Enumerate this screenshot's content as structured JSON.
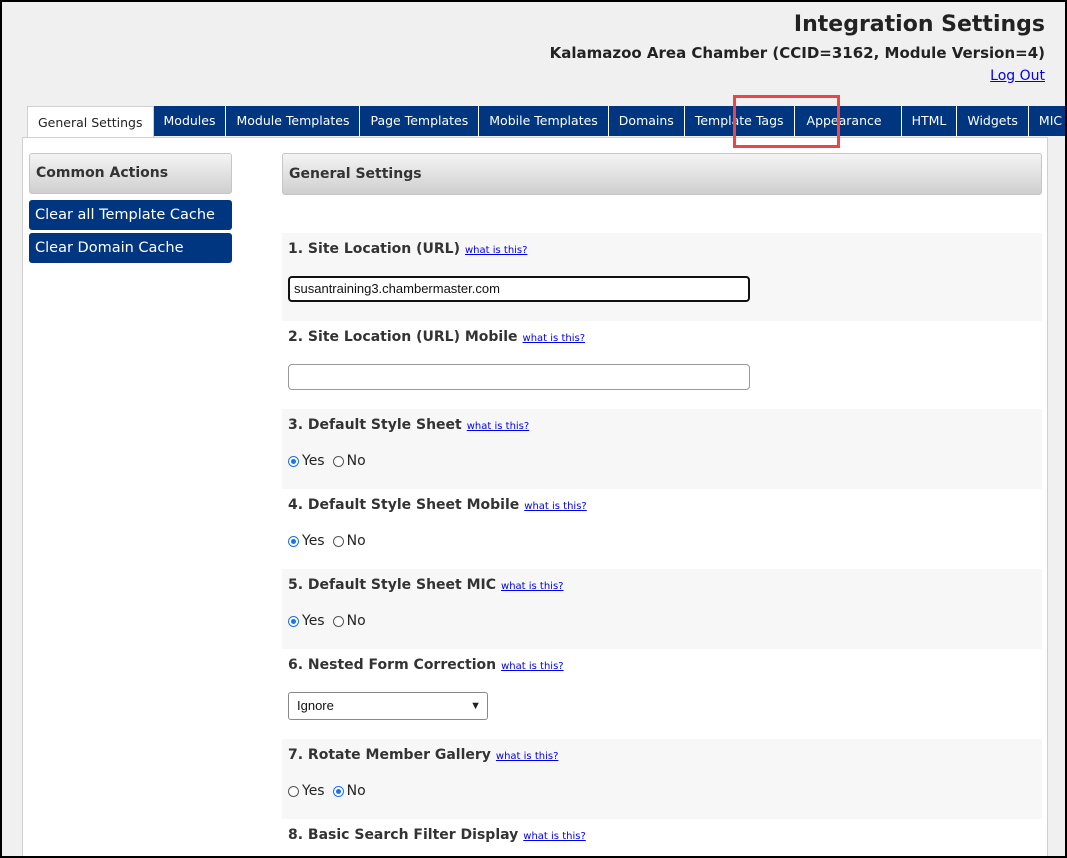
{
  "header": {
    "title": "Integration Settings",
    "subtitle": "Kalamazoo Area Chamber (CCID=3162, Module Version=4)",
    "logout": "Log Out"
  },
  "tabs": [
    {
      "label": "General Settings",
      "active": true
    },
    {
      "label": "Modules"
    },
    {
      "label": "Module Templates"
    },
    {
      "label": "Page Templates"
    },
    {
      "label": "Mobile Templates"
    },
    {
      "label": "Domains"
    },
    {
      "label": "Template Tags"
    },
    {
      "label": "Appearance",
      "highlighted": true
    },
    {
      "label": "HTML"
    },
    {
      "label": "Widgets"
    },
    {
      "label": "MIC"
    }
  ],
  "sidebar": {
    "title": "Common Actions",
    "actions": [
      "Clear all Template Cache",
      "Clear Domain Cache"
    ]
  },
  "main": {
    "title": "General Settings",
    "help_link": "what is this?",
    "fields": [
      {
        "label": "1. Site Location (URL)",
        "value": "susantraining3.chambermaster.com"
      },
      {
        "label": "2. Site Location (URL) Mobile",
        "value": ""
      },
      {
        "label": "3. Default Style Sheet",
        "yes": "Yes",
        "no": "No",
        "selected": "Yes"
      },
      {
        "label": "4. Default Style Sheet Mobile",
        "yes": "Yes",
        "no": "No",
        "selected": "Yes"
      },
      {
        "label": "5. Default Style Sheet MIC",
        "yes": "Yes",
        "no": "No",
        "selected": "Yes"
      },
      {
        "label": "6. Nested Form Correction",
        "selected": "Ignore"
      },
      {
        "label": "7. Rotate Member Gallery",
        "yes": "Yes",
        "no": "No",
        "selected": "No"
      },
      {
        "label": "8. Basic Search Filter Display"
      }
    ]
  },
  "colors": {
    "tab_bg": "#003580",
    "highlight": "#e84747",
    "link": "#0000ee"
  }
}
